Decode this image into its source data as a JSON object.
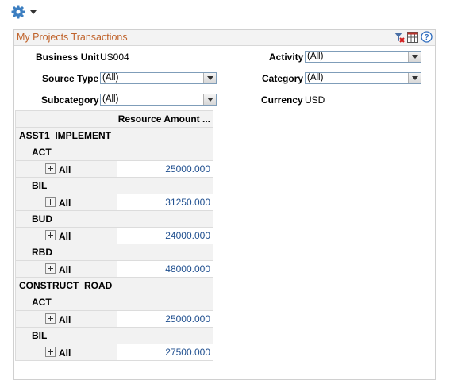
{
  "toolbar": {
    "gear_icon": "gear-icon",
    "menu_icon": "chevron-down-icon"
  },
  "panel": {
    "title": "My Projects Transactions",
    "icons": [
      "filter-clear-icon",
      "grid-icon",
      "help-icon"
    ]
  },
  "filters": {
    "business_unit": {
      "label": "Business Unit",
      "value": "US004"
    },
    "activity": {
      "label": "Activity",
      "value": "(All)"
    },
    "source_type": {
      "label": "Source Type",
      "value": "(All)"
    },
    "category": {
      "label": "Category",
      "value": "(All)"
    },
    "subcategory": {
      "label": "Subcategory",
      "value": "(All)"
    },
    "currency": {
      "label": "Currency",
      "value": "USD"
    }
  },
  "grid": {
    "column_header": "Resource Amount ...",
    "rows": [
      {
        "type": "group",
        "label": "ASST1_IMPLEMENT"
      },
      {
        "type": "sub",
        "label": "ACT"
      },
      {
        "type": "item",
        "label": "All",
        "amount": "25000.000"
      },
      {
        "type": "sub",
        "label": "BIL"
      },
      {
        "type": "item",
        "label": "All",
        "amount": "31250.000"
      },
      {
        "type": "sub",
        "label": "BUD"
      },
      {
        "type": "item",
        "label": "All",
        "amount": "24000.000"
      },
      {
        "type": "sub",
        "label": "RBD"
      },
      {
        "type": "item",
        "label": "All",
        "amount": "48000.000"
      },
      {
        "type": "group",
        "label": "CONSTRUCT_ROAD"
      },
      {
        "type": "sub",
        "label": "ACT"
      },
      {
        "type": "item",
        "label": "All",
        "amount": "25000.000"
      },
      {
        "type": "sub",
        "label": "BIL"
      },
      {
        "type": "item",
        "label": "All",
        "amount": "27500.000"
      }
    ]
  }
}
